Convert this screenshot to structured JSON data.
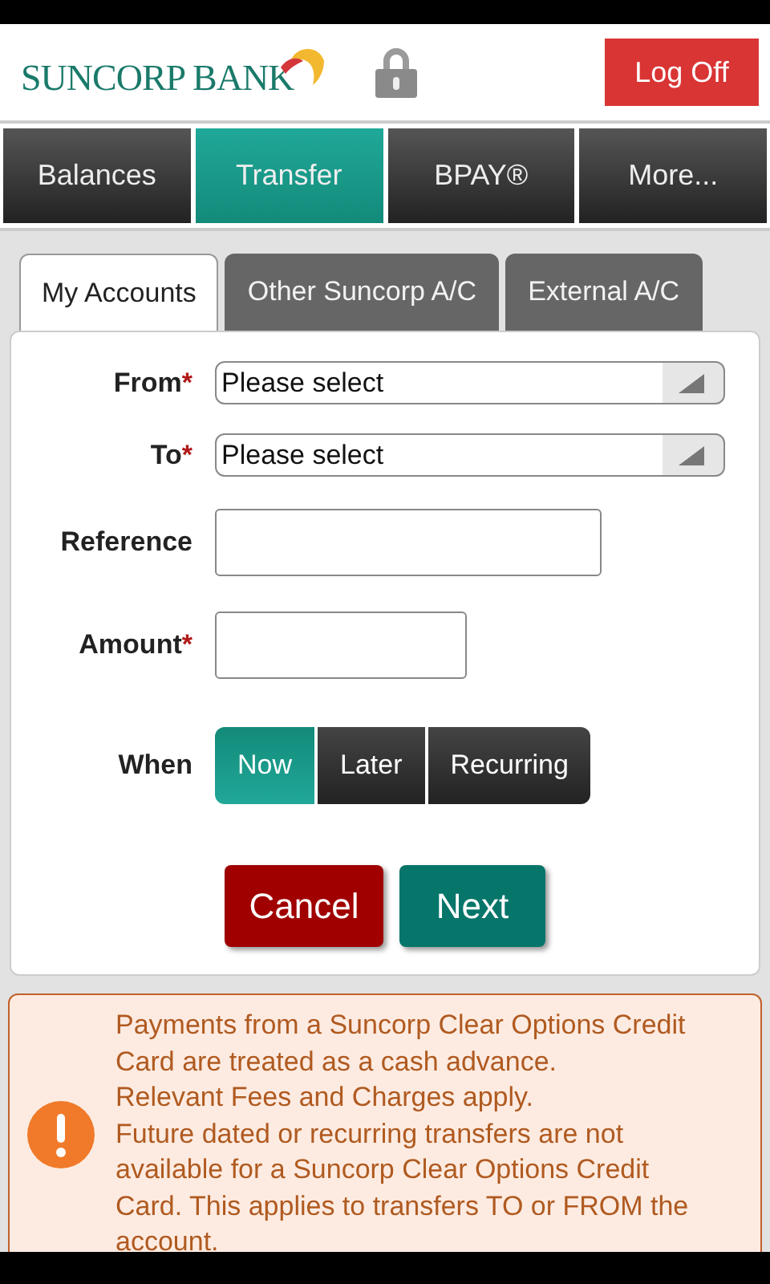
{
  "header": {
    "logo": "SUNCORP BANK",
    "logoff": "Log Off"
  },
  "nav_tabs": [
    {
      "label": "Balances",
      "selected": false
    },
    {
      "label": "Transfer",
      "selected": true
    },
    {
      "label": "BPAY®",
      "selected": false
    },
    {
      "label": "More...",
      "selected": false
    }
  ],
  "sub_tabs": [
    {
      "label": "My Accounts",
      "selected": true
    },
    {
      "label": "Other Suncorp A/C",
      "selected": false
    },
    {
      "label": "External A/C",
      "selected": false
    }
  ],
  "form": {
    "fields": [
      {
        "kind": "select",
        "label": "From",
        "required_mark": "*",
        "value": "Please select"
      },
      {
        "kind": "select",
        "label": "To",
        "required_mark": "*",
        "value": "Please select"
      },
      {
        "kind": "widetext",
        "label": "Reference"
      },
      {
        "kind": "shorttext",
        "label": "Amount",
        "required_mark": "*"
      }
    ],
    "when": {
      "label": "When",
      "options": [
        {
          "label": "Now",
          "selected": true
        },
        {
          "label": "Later",
          "selected": false
        },
        {
          "label": "Recurring",
          "selected": false
        }
      ]
    },
    "buttons": [
      {
        "label": "Cancel",
        "kind": "cancel"
      },
      {
        "label": "Next",
        "kind": "primary"
      }
    ]
  },
  "notice": {
    "lines": [
      "Payments from a Suncorp Clear Options Credit Card are treated as a cash advance.",
      "Relevant Fees and Charges apply.",
      "Future dated or recurring transfers are not available for a Suncorp Clear Options Credit Card. This applies to transfers TO or FROM the account."
    ]
  }
}
